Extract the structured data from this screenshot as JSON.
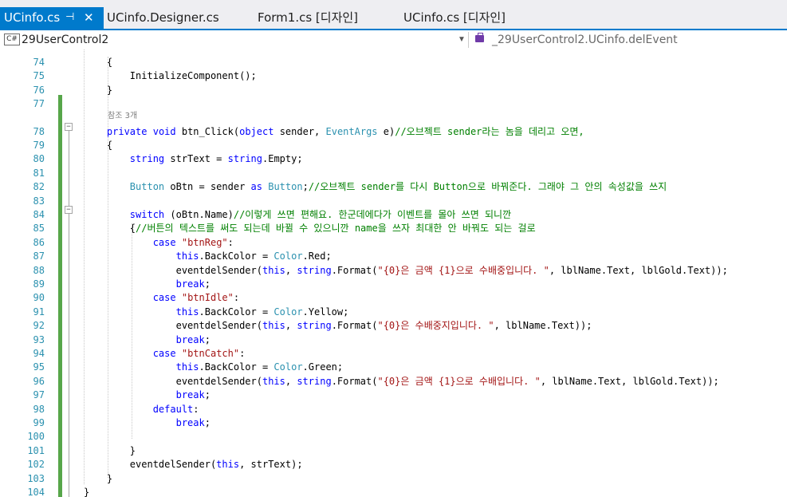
{
  "tabs": [
    {
      "label": "UCinfo.cs",
      "active": true,
      "pinned": true,
      "closable": true
    },
    {
      "label": "UCinfo.Designer.cs"
    },
    {
      "label": "Form1.cs [디자인]"
    },
    {
      "label": "UCinfo.cs [디자인]"
    }
  ],
  "tab_icons": {
    "pin": "pin-icon",
    "close": "close-icon"
  },
  "navbar": {
    "project_icon": "C#",
    "project": "29UserControl2",
    "member": "_29UserControl2.UCinfo.delEvent"
  },
  "codelens": "참조 3개",
  "lines": [
    {
      "num": "74",
      "segs": [
        {
          "t": "        {",
          "c": ""
        }
      ]
    },
    {
      "num": "75",
      "segs": [
        {
          "t": "            InitializeComponent();",
          "c": ""
        }
      ]
    },
    {
      "num": "76",
      "segs": [
        {
          "t": "        }",
          "c": ""
        }
      ]
    },
    {
      "num": "77",
      "segs": []
    },
    {
      "num": "78",
      "segs": [
        {
          "t": "        ",
          "c": ""
        },
        {
          "t": "private",
          "c": "kw"
        },
        {
          "t": " ",
          "c": ""
        },
        {
          "t": "void",
          "c": "kw"
        },
        {
          "t": " btn_Click(",
          "c": ""
        },
        {
          "t": "object",
          "c": "kw"
        },
        {
          "t": " sender, ",
          "c": ""
        },
        {
          "t": "EventArgs",
          "c": "ty"
        },
        {
          "t": " e)",
          "c": ""
        },
        {
          "t": "//오브젝트 sender라는 놈을 데리고 오면,",
          "c": "cm"
        }
      ]
    },
    {
      "num": "79",
      "segs": [
        {
          "t": "        {",
          "c": ""
        }
      ]
    },
    {
      "num": "80",
      "segs": [
        {
          "t": "            ",
          "c": ""
        },
        {
          "t": "string",
          "c": "kw"
        },
        {
          "t": " strText = ",
          "c": ""
        },
        {
          "t": "string",
          "c": "kw"
        },
        {
          "t": ".Empty;",
          "c": ""
        }
      ]
    },
    {
      "num": "81",
      "segs": []
    },
    {
      "num": "82",
      "segs": [
        {
          "t": "            ",
          "c": ""
        },
        {
          "t": "Button",
          "c": "ty"
        },
        {
          "t": " oBtn = sender ",
          "c": ""
        },
        {
          "t": "as",
          "c": "kw"
        },
        {
          "t": " ",
          "c": ""
        },
        {
          "t": "Button",
          "c": "ty"
        },
        {
          "t": ";",
          "c": ""
        },
        {
          "t": "//오브젝트 sender를 다시 Button으로 바꿔준다. 그래야 그 안의 속성값을 쓰지",
          "c": "cm"
        }
      ]
    },
    {
      "num": "83",
      "segs": []
    },
    {
      "num": "84",
      "segs": [
        {
          "t": "            ",
          "c": ""
        },
        {
          "t": "switch",
          "c": "kw"
        },
        {
          "t": " (oBtn.Name)",
          "c": ""
        },
        {
          "t": "//이렇게 쓰면 편해요. 한군데에다가 이벤트를 몰아 쓰면 되니깐",
          "c": "cm"
        }
      ]
    },
    {
      "num": "85",
      "segs": [
        {
          "t": "            {",
          "c": ""
        },
        {
          "t": "//버튼의 텍스트를 써도 되는데 바뀔 수 있으니깐 name을 쓰자 최대한 안 바꿔도 되는 걸로",
          "c": "cm"
        }
      ]
    },
    {
      "num": "86",
      "segs": [
        {
          "t": "                ",
          "c": ""
        },
        {
          "t": "case",
          "c": "kw"
        },
        {
          "t": " ",
          "c": ""
        },
        {
          "t": "\"btnReg\"",
          "c": "str"
        },
        {
          "t": ":",
          "c": ""
        }
      ]
    },
    {
      "num": "87",
      "segs": [
        {
          "t": "                    ",
          "c": ""
        },
        {
          "t": "this",
          "c": "kw"
        },
        {
          "t": ".BackColor = ",
          "c": ""
        },
        {
          "t": "Color",
          "c": "ty"
        },
        {
          "t": ".Red;",
          "c": ""
        }
      ]
    },
    {
      "num": "88",
      "segs": [
        {
          "t": "                    eventdelSender(",
          "c": ""
        },
        {
          "t": "this",
          "c": "kw"
        },
        {
          "t": ", ",
          "c": ""
        },
        {
          "t": "string",
          "c": "kw"
        },
        {
          "t": ".Format(",
          "c": ""
        },
        {
          "t": "\"{0}은 금액 {1}으로 수배중입니다. \"",
          "c": "str"
        },
        {
          "t": ", lblName.Text, lblGold.Text));",
          "c": ""
        }
      ]
    },
    {
      "num": "89",
      "segs": [
        {
          "t": "                    ",
          "c": ""
        },
        {
          "t": "break",
          "c": "kw"
        },
        {
          "t": ";",
          "c": ""
        }
      ]
    },
    {
      "num": "90",
      "segs": [
        {
          "t": "                ",
          "c": ""
        },
        {
          "t": "case",
          "c": "kw"
        },
        {
          "t": " ",
          "c": ""
        },
        {
          "t": "\"btnIdle\"",
          "c": "str"
        },
        {
          "t": ":",
          "c": ""
        }
      ]
    },
    {
      "num": "91",
      "segs": [
        {
          "t": "                    ",
          "c": ""
        },
        {
          "t": "this",
          "c": "kw"
        },
        {
          "t": ".BackColor = ",
          "c": ""
        },
        {
          "t": "Color",
          "c": "ty"
        },
        {
          "t": ".Yellow;",
          "c": ""
        }
      ]
    },
    {
      "num": "92",
      "segs": [
        {
          "t": "                    eventdelSender(",
          "c": ""
        },
        {
          "t": "this",
          "c": "kw"
        },
        {
          "t": ", ",
          "c": ""
        },
        {
          "t": "string",
          "c": "kw"
        },
        {
          "t": ".Format(",
          "c": ""
        },
        {
          "t": "\"{0}은 수배중지입니다. \"",
          "c": "str"
        },
        {
          "t": ", lblName.Text));",
          "c": ""
        }
      ]
    },
    {
      "num": "93",
      "segs": [
        {
          "t": "                    ",
          "c": ""
        },
        {
          "t": "break",
          "c": "kw"
        },
        {
          "t": ";",
          "c": ""
        }
      ]
    },
    {
      "num": "94",
      "segs": [
        {
          "t": "                ",
          "c": ""
        },
        {
          "t": "case",
          "c": "kw"
        },
        {
          "t": " ",
          "c": ""
        },
        {
          "t": "\"btnCatch\"",
          "c": "str"
        },
        {
          "t": ":",
          "c": ""
        }
      ]
    },
    {
      "num": "95",
      "segs": [
        {
          "t": "                    ",
          "c": ""
        },
        {
          "t": "this",
          "c": "kw"
        },
        {
          "t": ".BackColor = ",
          "c": ""
        },
        {
          "t": "Color",
          "c": "ty"
        },
        {
          "t": ".Green;",
          "c": ""
        }
      ]
    },
    {
      "num": "96",
      "segs": [
        {
          "t": "                    eventdelSender(",
          "c": ""
        },
        {
          "t": "this",
          "c": "kw"
        },
        {
          "t": ", ",
          "c": ""
        },
        {
          "t": "string",
          "c": "kw"
        },
        {
          "t": ".Format(",
          "c": ""
        },
        {
          "t": "\"{0}은 금액 {1}으로 수배입니다. \"",
          "c": "str"
        },
        {
          "t": ", lblName.Text, lblGold.Text));",
          "c": ""
        }
      ]
    },
    {
      "num": "97",
      "segs": [
        {
          "t": "                    ",
          "c": ""
        },
        {
          "t": "break",
          "c": "kw"
        },
        {
          "t": ";",
          "c": ""
        }
      ]
    },
    {
      "num": "98",
      "segs": [
        {
          "t": "                ",
          "c": ""
        },
        {
          "t": "default",
          "c": "kw"
        },
        {
          "t": ":",
          "c": ""
        }
      ]
    },
    {
      "num": "99",
      "segs": [
        {
          "t": "                    ",
          "c": ""
        },
        {
          "t": "break",
          "c": "kw"
        },
        {
          "t": ";",
          "c": ""
        }
      ]
    },
    {
      "num": "100",
      "segs": []
    },
    {
      "num": "101",
      "segs": [
        {
          "t": "            }",
          "c": ""
        }
      ]
    },
    {
      "num": "102",
      "segs": [
        {
          "t": "            eventdelSender(",
          "c": ""
        },
        {
          "t": "this",
          "c": "kw"
        },
        {
          "t": ", strText);",
          "c": ""
        }
      ]
    },
    {
      "num": "103",
      "segs": [
        {
          "t": "        }",
          "c": ""
        }
      ]
    },
    {
      "num": "104",
      "segs": [
        {
          "t": "    }",
          "c": ""
        }
      ]
    }
  ],
  "colors": {
    "tab_active": "#007acc",
    "keyword": "#0000ff",
    "type": "#2b91af",
    "string": "#a31515",
    "comment": "#008000",
    "line_number": "#2b91af",
    "change_bar": "#57a64a"
  }
}
